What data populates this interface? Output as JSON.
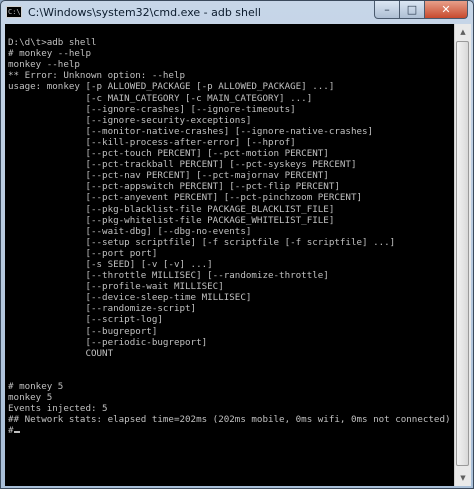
{
  "window": {
    "title": "C:\\Windows\\system32\\cmd.exe - adb  shell",
    "icon_text": "C:\\"
  },
  "controls": {
    "minimize": "–",
    "maximize": "□",
    "close": "✕"
  },
  "console": {
    "lines": [
      "",
      "D:\\d\\t>adb shell",
      "# monkey --help",
      "monkey --help",
      "** Error: Unknown option: --help",
      "usage: monkey [-p ALLOWED_PACKAGE [-p ALLOWED_PACKAGE] ...]",
      "              [-c MAIN_CATEGORY [-c MAIN_CATEGORY] ...]",
      "              [--ignore-crashes] [--ignore-timeouts]",
      "              [--ignore-security-exceptions]",
      "              [--monitor-native-crashes] [--ignore-native-crashes]",
      "              [--kill-process-after-error] [--hprof]",
      "              [--pct-touch PERCENT] [--pct-motion PERCENT]",
      "              [--pct-trackball PERCENT] [--pct-syskeys PERCENT]",
      "              [--pct-nav PERCENT] [--pct-majornav PERCENT]",
      "              [--pct-appswitch PERCENT] [--pct-flip PERCENT]",
      "              [--pct-anyevent PERCENT] [--pct-pinchzoom PERCENT]",
      "              [--pkg-blacklist-file PACKAGE_BLACKLIST_FILE]",
      "              [--pkg-whitelist-file PACKAGE_WHITELIST_FILE]",
      "              [--wait-dbg] [--dbg-no-events]",
      "              [--setup scriptfile] [-f scriptfile [-f scriptfile] ...]",
      "              [--port port]",
      "              [-s SEED] [-v [-v] ...]",
      "              [--throttle MILLISEC] [--randomize-throttle]",
      "              [--profile-wait MILLISEC]",
      "              [--device-sleep-time MILLISEC]",
      "              [--randomize-script]",
      "              [--script-log]",
      "              [--bugreport]",
      "              [--periodic-bugreport]",
      "              COUNT",
      "",
      "",
      "# monkey 5",
      "monkey 5",
      "Events injected: 5",
      "## Network stats: elapsed time=202ms (202ms mobile, 0ms wifi, 0ms not connected)",
      "#"
    ]
  },
  "scrollbar": {
    "up_arrow": "▲",
    "down_arrow": "▼"
  }
}
